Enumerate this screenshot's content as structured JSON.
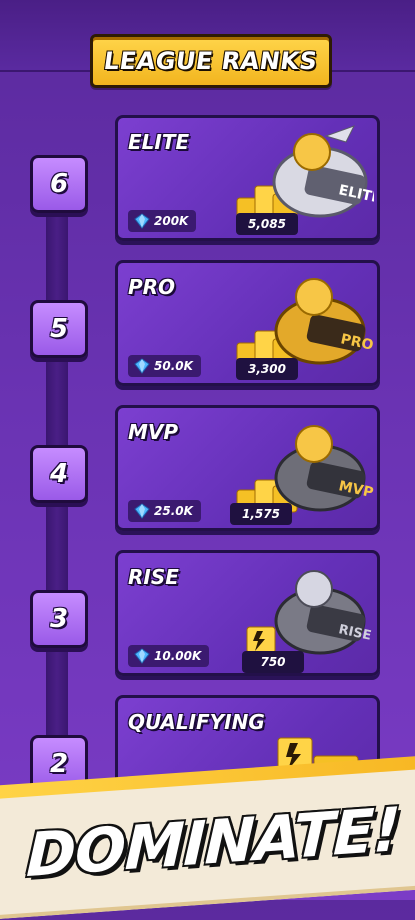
{
  "header": {
    "title": "LEAGUE RANKS"
  },
  "colors": {
    "accent_gold": "#f2b51f",
    "card_purple": "#6a33b3",
    "badge_purple": "#b070f8"
  },
  "ranks": [
    {
      "level": "6",
      "name": "ELITE",
      "gems": "200K",
      "coins": "5,085",
      "ring_label": "ELITE",
      "ring_metal": "silver"
    },
    {
      "level": "5",
      "name": "PRO",
      "gems": "50.0K",
      "coins": "3,300",
      "ring_label": "PRO",
      "ring_metal": "gold"
    },
    {
      "level": "4",
      "name": "MVP",
      "gems": "25.0K",
      "coins": "1,575",
      "ring_label": "MVP",
      "ring_metal": "dark"
    },
    {
      "level": "3",
      "name": "RISE",
      "gems": "10.00K",
      "coins": "750",
      "ring_label": "RISE",
      "ring_metal": "dark"
    },
    {
      "level": "2",
      "name": "QUALIFYING",
      "gems": "",
      "coins": "",
      "ring_label": "",
      "ring_metal": ""
    }
  ],
  "footer": {
    "slogan": "DOMINATE!"
  },
  "icons": {
    "gem": "blue-gem-icon",
    "coins": "gold-coin-stack-icon",
    "ring": "championship-ring-icon"
  }
}
